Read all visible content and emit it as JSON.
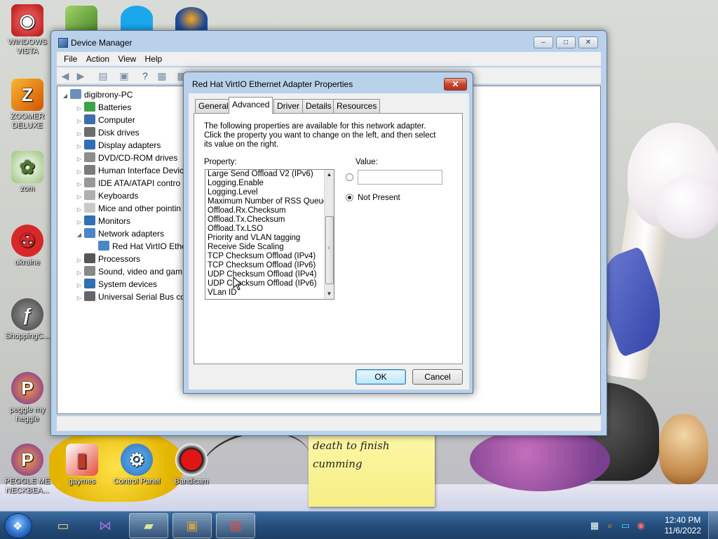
{
  "desktop": {
    "icons": [
      {
        "label": "WINDOWS VISTA",
        "icon": "windows-vista-icon"
      },
      {
        "label": "ZOOMER DELUXE",
        "icon": "zoomer-icon"
      },
      {
        "label": "zom",
        "icon": "zom-icon"
      },
      {
        "label": "ukraine",
        "icon": "radiation-icon"
      },
      {
        "label": "ShoppingC...",
        "icon": "flash-icon"
      },
      {
        "label": "peggle my heggle",
        "icon": "peggle-icon"
      },
      {
        "label": "PEGGLE ME NECKBEA...",
        "icon": "peggle-icon"
      },
      {
        "label": "gaymes",
        "icon": "folder-icon"
      },
      {
        "label": "Control Panel",
        "icon": "control-panel-icon"
      },
      {
        "label": "Bandicam",
        "icon": "record-icon"
      }
    ],
    "sticky_note": {
      "line1": "death to finish",
      "line2": "cumming"
    },
    "colors": {
      "accent_blue": "#b9d1ea",
      "taskbar": "#254e7c",
      "close_red": "#c8452f"
    }
  },
  "device_manager": {
    "title": "Device Manager",
    "menu": [
      "File",
      "Action",
      "View",
      "Help"
    ],
    "controls": {
      "minimize": "–",
      "maximize": "□",
      "close": "✕"
    },
    "tree": {
      "root": "digibrony-PC",
      "items": [
        {
          "label": "Batteries",
          "icon": "battery-icon"
        },
        {
          "label": "Computer",
          "icon": "computer-icon"
        },
        {
          "label": "Disk drives",
          "icon": "disk-drive-icon"
        },
        {
          "label": "Display adapters",
          "icon": "monitor-icon"
        },
        {
          "label": "DVD/CD-ROM drives",
          "icon": "dvd-icon"
        },
        {
          "label": "Human Interface Devic",
          "icon": "hid-icon"
        },
        {
          "label": "IDE ATA/ATAPI contro",
          "icon": "ide-icon"
        },
        {
          "label": "Keyboards",
          "icon": "keyboard-icon"
        },
        {
          "label": "Mice and other pointin",
          "icon": "mouse-icon"
        },
        {
          "label": "Monitors",
          "icon": "monitor-icon"
        },
        {
          "label": "Network adapters",
          "icon": "network-icon"
        },
        {
          "label": "Red Hat VirtIO Ethe",
          "icon": "network-icon"
        },
        {
          "label": "Processors",
          "icon": "processor-icon"
        },
        {
          "label": "Sound, video and gam",
          "icon": "sound-icon"
        },
        {
          "label": "System devices",
          "icon": "system-icon"
        },
        {
          "label": "Universal Serial Bus co",
          "icon": "usb-icon"
        }
      ]
    }
  },
  "dialog": {
    "title": "Red Hat VirtIO Ethernet Adapter Properties",
    "close": "✕",
    "tabs": [
      "General",
      "Advanced",
      "Driver",
      "Details",
      "Resources"
    ],
    "active_tab": "Advanced",
    "description": "The following properties are available for this network adapter. Click the property you want to change on the left, and then select its value on the right.",
    "property_label": "Property:",
    "value_label": "Value:",
    "properties": [
      "Large Send Offload V2 (IPv6)",
      "Logging.Enable",
      "Logging.Level",
      "Maximum Number of RSS Queues",
      "Offload.Rx.Checksum",
      "Offload.Tx.Checksum",
      "Offload.Tx.LSO",
      "Priority and VLAN tagging",
      "Receive Side Scaling",
      "TCP Checksum Offload (IPv4)",
      "TCP Checksum Offload (IPv6)",
      "UDP Checksum Offload (IPv4)",
      "UDP Checksum Offload (IPv6)",
      "VLan ID"
    ],
    "value_input": "",
    "not_present_label": "Not Present",
    "ok_label": "OK",
    "cancel_label": "Cancel"
  },
  "taskbar": {
    "time": "12:40 PM",
    "date": "11/6/2022"
  }
}
